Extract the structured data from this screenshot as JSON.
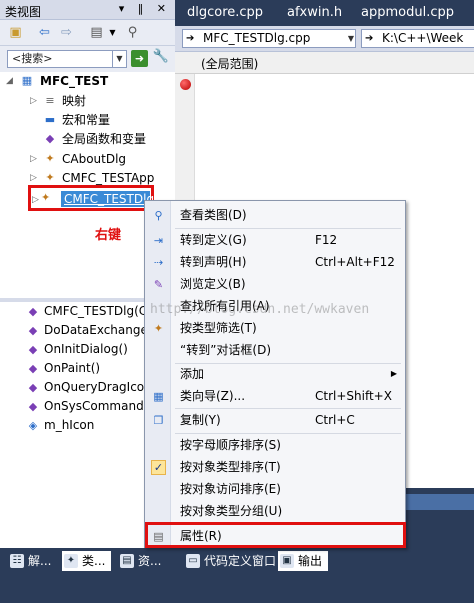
{
  "class_view": {
    "title": "类视图",
    "title_buttons": "▾ ‖ ✕",
    "search": {
      "value": "<搜索>"
    },
    "tree": {
      "project": "MFC_TEST",
      "items": [
        {
          "label": "映射",
          "icon": "map-icon"
        },
        {
          "label": "宏和常量",
          "icon": "macro-icon"
        },
        {
          "label": "全局函数和变量",
          "icon": "global-icon"
        },
        {
          "label": "CAboutDlg",
          "icon": "class-icon"
        },
        {
          "label": "CMFC_TESTApp",
          "icon": "class-icon"
        }
      ],
      "selected": "CMFC_TESTDlg"
    },
    "annotation": "右键",
    "members": [
      "CMFC_TESTDlg(CWnd",
      "DoDataExchange(CD",
      "OnInitDialog()",
      "OnPaint()",
      "OnQueryDragIcon",
      "OnSysCommand(UI",
      "m_hIcon"
    ]
  },
  "editor": {
    "doc_tabs": [
      "dlgcore.cpp",
      "afxwin.h",
      "appmodul.cpp"
    ],
    "nav": {
      "file_combo": "MFC_TESTDlg.cpp",
      "path_combo": "K:\\C++\\Week"
    },
    "scope": "(全局范围)"
  },
  "context_menu": {
    "items": [
      {
        "label": "查看类图(D)",
        "shortcut": "",
        "icon": "class-diagram-icon"
      },
      {
        "label": "转到定义(G)",
        "shortcut": "F12",
        "icon": "goto-definition-icon"
      },
      {
        "label": "转到声明(H)",
        "shortcut": "Ctrl+Alt+F12",
        "icon": "goto-declaration-icon"
      },
      {
        "label": "浏览定义(B)",
        "shortcut": "",
        "icon": "browse-definition-icon"
      },
      {
        "label": "查找所有引用(A)",
        "shortcut": "",
        "icon": ""
      },
      {
        "label": "按类型筛选(T)",
        "shortcut": "",
        "icon": "filter-icon"
      },
      {
        "label": "“转到”对话框(D)",
        "shortcut": "",
        "icon": ""
      },
      {
        "label": "添加",
        "shortcut": "",
        "icon": ""
      },
      {
        "label": "类向导(Z)...",
        "shortcut": "Ctrl+Shift+X",
        "icon": "class-wizard-icon"
      },
      {
        "label": "复制(Y)",
        "shortcut": "Ctrl+C",
        "icon": "copy-icon"
      },
      {
        "label": "按字母顺序排序(S)",
        "shortcut": "",
        "icon": ""
      },
      {
        "label": "按对象类型排序(T)",
        "shortcut": "",
        "icon": "check-icon"
      },
      {
        "label": "按对象访问排序(E)",
        "shortcut": "",
        "icon": ""
      },
      {
        "label": "按对象类型分组(U)",
        "shortcut": "",
        "icon": ""
      },
      {
        "label": "属性(R)",
        "shortcut": "",
        "icon": "properties-icon"
      }
    ]
  },
  "bottom_tabs": [
    {
      "label": "解...",
      "icon": "solution-explorer-icon"
    },
    {
      "label": "类...",
      "icon": "class-view-icon",
      "active": true
    },
    {
      "label": "资...",
      "icon": "resource-view-icon"
    },
    {
      "label": "代码定义窗口",
      "icon": "code-definition-icon"
    },
    {
      "label": "输出",
      "icon": "output-icon"
    }
  ],
  "watermark": "http://blog.csdn.net/wwkaven",
  "colors": {
    "ide_background": "#2b3c59",
    "panel_header": "#d6dbe9",
    "selection": "#3a8ad6",
    "highlight_box": "#e01010"
  }
}
